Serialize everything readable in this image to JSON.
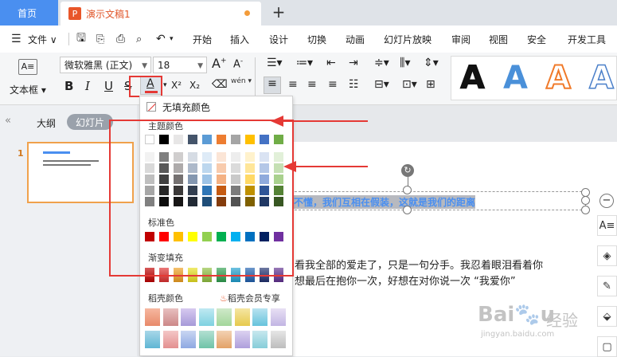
{
  "titlebar": {
    "home_tab": "首页",
    "doc_tab": "演示文稿1",
    "doc_icon": "P",
    "new_tab": "+"
  },
  "menubar": {
    "file_menu": "文件",
    "items": [
      "开始",
      "插入",
      "设计",
      "切换",
      "动画",
      "幻灯片放映",
      "审阅",
      "视图",
      "安全",
      "开发工具"
    ]
  },
  "ribbon": {
    "textbox_label": "文本框",
    "font_name": "微软雅黑 (正文)",
    "font_size": "18",
    "grow_font": "A",
    "shrink_font": "A",
    "bold": "B",
    "italic": "I",
    "underline": "U",
    "strike": "S",
    "font_color": "A",
    "superscript": "X²",
    "subscript": "X₂",
    "phonetic": "wén",
    "art_styles": [
      "A",
      "A",
      "A",
      "A"
    ],
    "art_colors": [
      "#111111",
      "#4a90d9",
      "#f07a2a",
      "#4a7fc9"
    ]
  },
  "leftpanel": {
    "collapse": "«",
    "outline_tab": "大纲",
    "slides_tab": "幻灯片",
    "slide_number": "1"
  },
  "color_panel": {
    "no_fill": "无填充颜色",
    "theme_label": "主题颜色",
    "standard_label": "标准色",
    "gradient_label": "渐变填充",
    "docer_label": "稻壳颜色",
    "docer_vip_label": "稻壳会员专享",
    "theme_top_row": [
      "#ffffff",
      "#000000",
      "#e7e6e6",
      "#44546a",
      "#5b9bd5",
      "#ed7d31",
      "#a5a5a5",
      "#ffc000",
      "#4472c4",
      "#70ad47"
    ],
    "theme_columns": [
      [
        "#f2f2f2",
        "#d9d9d9",
        "#bfbfbf",
        "#a6a6a6",
        "#808080"
      ],
      [
        "#7f7f7f",
        "#595959",
        "#404040",
        "#262626",
        "#0d0d0d"
      ],
      [
        "#d0cece",
        "#aeabab",
        "#757171",
        "#3a3838",
        "#171616"
      ],
      [
        "#d6dce4",
        "#adb9ca",
        "#8497b0",
        "#333f50",
        "#222a35"
      ],
      [
        "#deebf7",
        "#bdd7ee",
        "#9dc3e6",
        "#2e75b6",
        "#1f4e79"
      ],
      [
        "#fbe5d6",
        "#f8cbad",
        "#f4b183",
        "#c55a11",
        "#843c0c"
      ],
      [
        "#ededed",
        "#dbdbdb",
        "#c9c9c9",
        "#7b7b7b",
        "#525252"
      ],
      [
        "#fff2cc",
        "#ffe699",
        "#ffd966",
        "#bf9000",
        "#7f6000"
      ],
      [
        "#dae3f3",
        "#b4c7e7",
        "#8faadc",
        "#2f5597",
        "#203864"
      ],
      [
        "#e2f0d9",
        "#c5e0b4",
        "#a9d18e",
        "#548235",
        "#385723"
      ]
    ],
    "standard_colors": [
      "#c00000",
      "#ff0000",
      "#ffc000",
      "#ffff00",
      "#92d050",
      "#00b050",
      "#00b0f0",
      "#0070c0",
      "#002060",
      "#7030a0"
    ],
    "gradient_colors": [
      "#c00000",
      "#e03030",
      "#f0a020",
      "#e8e020",
      "#90c040",
      "#30a050",
      "#20a0d0",
      "#2060b0",
      "#203070",
      "#603090"
    ]
  },
  "slide": {
    "title_text": "不懂，我们互相在假装，这就是我们的距离",
    "body_line1": "看我全部的爱走了，只是一句分手。我忍着眼泪看着你",
    "body_line2": "想最后在抱你一次，好想在对你说一次 “我爱你”"
  },
  "watermark": {
    "brand": "Bai",
    "brand2": "经验",
    "url": "jingyan.baidu.com"
  }
}
